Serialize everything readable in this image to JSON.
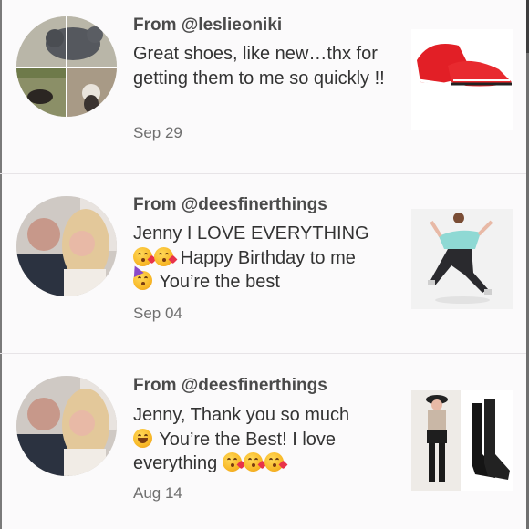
{
  "reviews": [
    {
      "from": "From @leslieoniki",
      "text": "Great shoes, like new…thx for getting them to me so quickly !!",
      "date": "Sep 29",
      "avatar_icon": "dogs-collage-photo",
      "thumbnail_icon": "red-sneakers-photo"
    },
    {
      "from": "From @deesfinerthings",
      "line1": "Jenny I LOVE EVERYTHING",
      "line2": "Happy Birthday to me",
      "line3": "You’re the best",
      "date": "Sep 04",
      "avatar_icon": "couple-selfie-photo",
      "thumbnail_icon": "woman-jumping-leggings-photo"
    },
    {
      "from": "From @deesfinerthings",
      "line1": "Jenny, Thank you so much",
      "line2": "You’re the Best! I love",
      "line3": "everything",
      "date": "Aug 14",
      "avatar_icon": "couple-selfie-photo",
      "thumbnail_icon": "black-boots-outfit-photo"
    }
  ],
  "colors": {
    "background": "#fbfafb",
    "text": "#333333",
    "muted": "#6f6f6f",
    "divider": "#e7e4e7"
  }
}
